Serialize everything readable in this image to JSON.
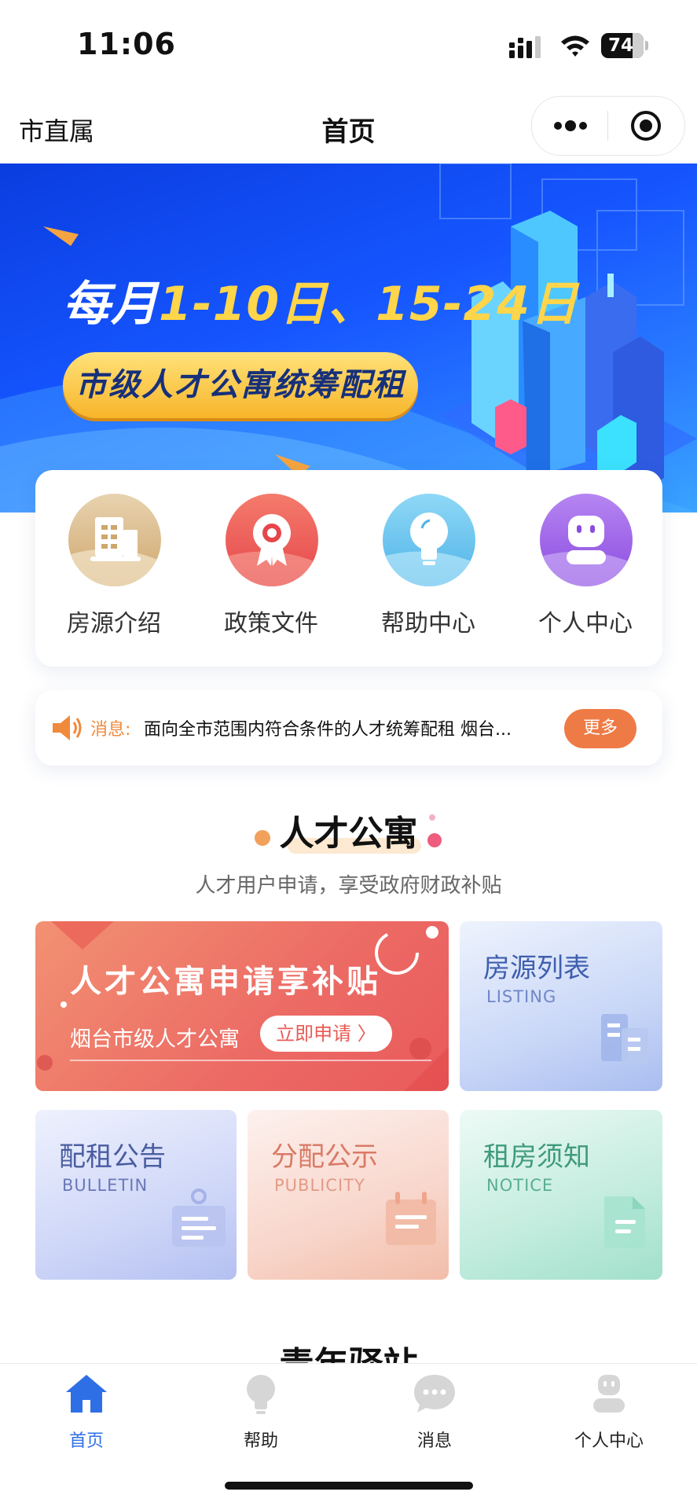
{
  "status_bar": {
    "time": "11:06",
    "battery": "74"
  },
  "nav": {
    "left_label": "市直属",
    "title": "首页"
  },
  "banner": {
    "line1_prefix": "每月",
    "line1_highlight": "1-10日、15-24日",
    "pill_text": "市级人才公寓统筹配租"
  },
  "quick_menu": [
    {
      "label": "房源介绍",
      "icon": "building-icon",
      "color": "#d9b98a"
    },
    {
      "label": "政策文件",
      "icon": "award-ribbon-icon",
      "color": "#ef6659"
    },
    {
      "label": "帮助中心",
      "icon": "lightbulb-icon",
      "color": "#6cc4ee"
    },
    {
      "label": "个人中心",
      "icon": "robot-user-icon",
      "color": "#a167e8"
    }
  ],
  "notice": {
    "label": "消息:",
    "text": "面向全市范围内符合条件的人才统筹配租 烟台...",
    "more": "更多"
  },
  "section": {
    "title": "人才公寓",
    "subtitle": "人才用户申请，享受政府财政补贴"
  },
  "promo": {
    "title": "人才公寓申请享补贴",
    "subtitle": "烟台市级人才公寓",
    "button": "立即申请 〉"
  },
  "tiles": {
    "listing": {
      "title": "房源列表",
      "sub": "LISTING"
    },
    "bulletin": {
      "title": "配租公告",
      "sub": "BULLETIN"
    },
    "publicity": {
      "title": "分配公示",
      "sub": "PUBLICITY"
    },
    "notice": {
      "title": "租房须知",
      "sub": "NOTICE"
    }
  },
  "section2": {
    "title": "青年驿站"
  },
  "tab_bar": [
    {
      "label": "首页",
      "icon": "home-icon",
      "active": true
    },
    {
      "label": "帮助",
      "icon": "lightbulb-icon",
      "active": false
    },
    {
      "label": "消息",
      "icon": "chat-bubble-icon",
      "active": false
    },
    {
      "label": "个人中心",
      "icon": "user-icon",
      "active": false
    }
  ],
  "colors": {
    "accent": "#2f6fe6",
    "banner_blue": "#1656ff",
    "highlight_yellow": "#ffd54a",
    "more_btn": "#ee7b45"
  }
}
